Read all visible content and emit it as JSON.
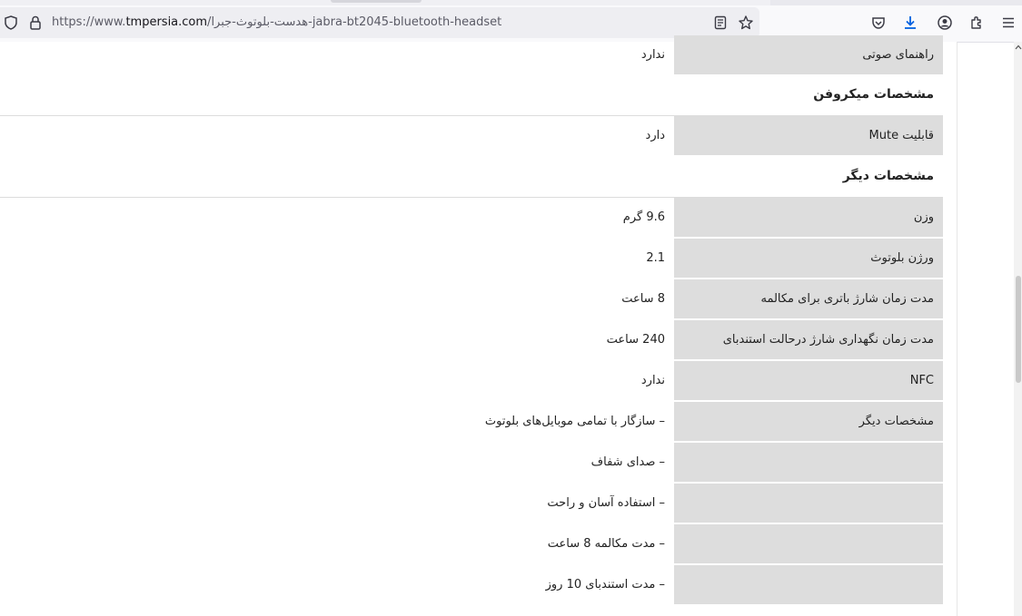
{
  "browser": {
    "url_prefix": "https://www.",
    "url_host": "tmpersia.com",
    "url_path": "/هدست-بلوتوث-جبرا-jabra-bt2045-bluetooth-headset"
  },
  "specs": {
    "row_voice_guide": {
      "label": "راهنمای صوتی",
      "value": "ندارد"
    },
    "section_mic": "مشخصات میکروفن",
    "row_mute": {
      "label": "قابلیت Mute",
      "value": "دارد"
    },
    "section_other": "مشخصات دیگر",
    "row_weight": {
      "label": "وزن",
      "value": "9.6 گرم"
    },
    "row_bt_version": {
      "label": "ورژن بلوتوث",
      "value": "2.1"
    },
    "row_talk_time": {
      "label": "مدت زمان شارژ باتری برای مکالمه",
      "value": "8 ساعت"
    },
    "row_standby": {
      "label": "مدت زمان نگهداری شارژ درحالت استندبای",
      "value": "240 ساعت"
    },
    "row_nfc": {
      "label": "NFC",
      "value": "ندارد"
    },
    "row_other_features": {
      "label": "مشخصات دیگر",
      "value": "– سازگار با تمامی موبایل‌های بلوتوث"
    },
    "row_feature_2": {
      "label": "",
      "value": "– صدای شفاف"
    },
    "row_feature_3": {
      "label": "",
      "value": "– استفاده آسان  و راحت"
    },
    "row_feature_4": {
      "label": "",
      "value": "– مدت  مکالمه 8 ساعت"
    },
    "row_feature_5": {
      "label": "",
      "value": "– مدت  استندبای 10 روز"
    }
  }
}
